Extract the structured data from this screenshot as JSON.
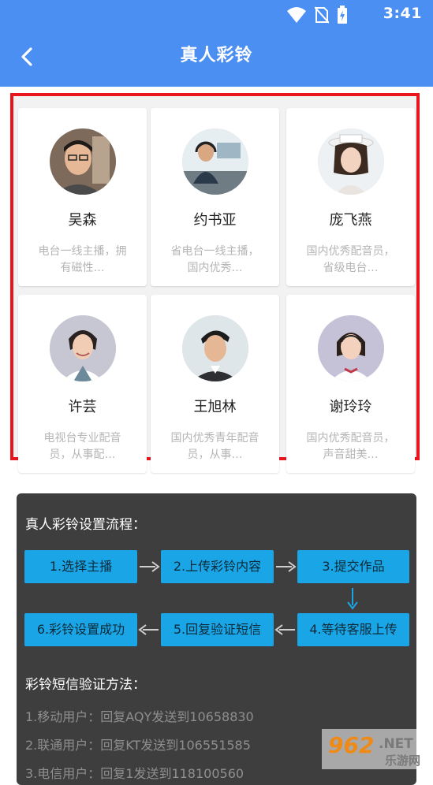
{
  "status_bar": {
    "time": "3:41"
  },
  "nav": {
    "title": "真人彩铃"
  },
  "announcers": [
    {
      "name": "吴森",
      "desc": "电台一线主播，拥有磁性…"
    },
    {
      "name": "约书亚",
      "desc": "省电台一线主播，国内优秀…"
    },
    {
      "name": "庞飞燕",
      "desc": "国内优秀配音员，省级电台…"
    },
    {
      "name": "许芸",
      "desc": "电视台专业配音员，从事配…"
    },
    {
      "name": "王旭林",
      "desc": "国内优秀青年配音员，从事…"
    },
    {
      "name": "谢玲玲",
      "desc": "国内优秀配音员，声音甜美…"
    }
  ],
  "process": {
    "title": "真人彩铃设置流程：",
    "steps": [
      "1.选择主播",
      "2.上传彩铃内容",
      "3.提交作品",
      "4.等待客服上传",
      "5.回复验证短信",
      "6.彩铃设置成功"
    ]
  },
  "sms": {
    "title": "彩铃短信验证方法：",
    "lines": [
      "1.移动用户：回复AQY发送到10658830",
      "2.联通用户：回复KT发送到106551585",
      "3.电信用户：回复1发送到118100560"
    ]
  },
  "watermark": {
    "number": "962",
    "suffix": ".NET",
    "site": "乐游网"
  }
}
